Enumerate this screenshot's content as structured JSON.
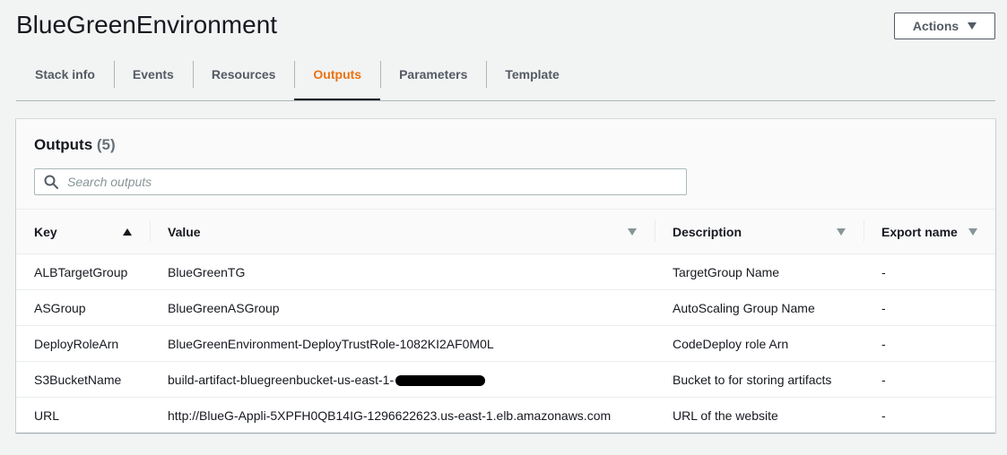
{
  "page": {
    "title": "BlueGreenEnvironment"
  },
  "actions": {
    "label": "Actions"
  },
  "tabs": [
    {
      "label": "Stack info"
    },
    {
      "label": "Events"
    },
    {
      "label": "Resources"
    },
    {
      "label": "Outputs"
    },
    {
      "label": "Parameters"
    },
    {
      "label": "Template"
    }
  ],
  "outputs": {
    "title": "Outputs",
    "count": "(5)",
    "search_placeholder": "Search outputs",
    "columns": {
      "key": "Key",
      "value": "Value",
      "description": "Description",
      "export_name": "Export name"
    },
    "rows": [
      {
        "key": "ALBTargetGroup",
        "value": "BlueGreenTG",
        "description": "TargetGroup Name",
        "export_name": "-"
      },
      {
        "key": "ASGroup",
        "value": "BlueGreenASGroup",
        "description": "AutoScaling Group Name",
        "export_name": "-"
      },
      {
        "key": "DeployRoleArn",
        "value": "BlueGreenEnvironment-DeployTrustRole-1082KI2AF0M0L",
        "description": "CodeDeploy role Arn",
        "export_name": "-"
      },
      {
        "key": "S3BucketName",
        "value": "build-artifact-bluegreenbucket-us-east-1-",
        "description": "Bucket to for storing artifacts",
        "export_name": "-"
      },
      {
        "key": "URL",
        "value": "http://BlueG-Appli-5XPFH0QB14IG-1296622623.us-east-1.elb.amazonaws.com",
        "description": "URL of the website",
        "export_name": "-"
      }
    ]
  },
  "colors": {
    "active_tab": "#ec7211",
    "text": "#16191f",
    "muted": "#545b64"
  }
}
